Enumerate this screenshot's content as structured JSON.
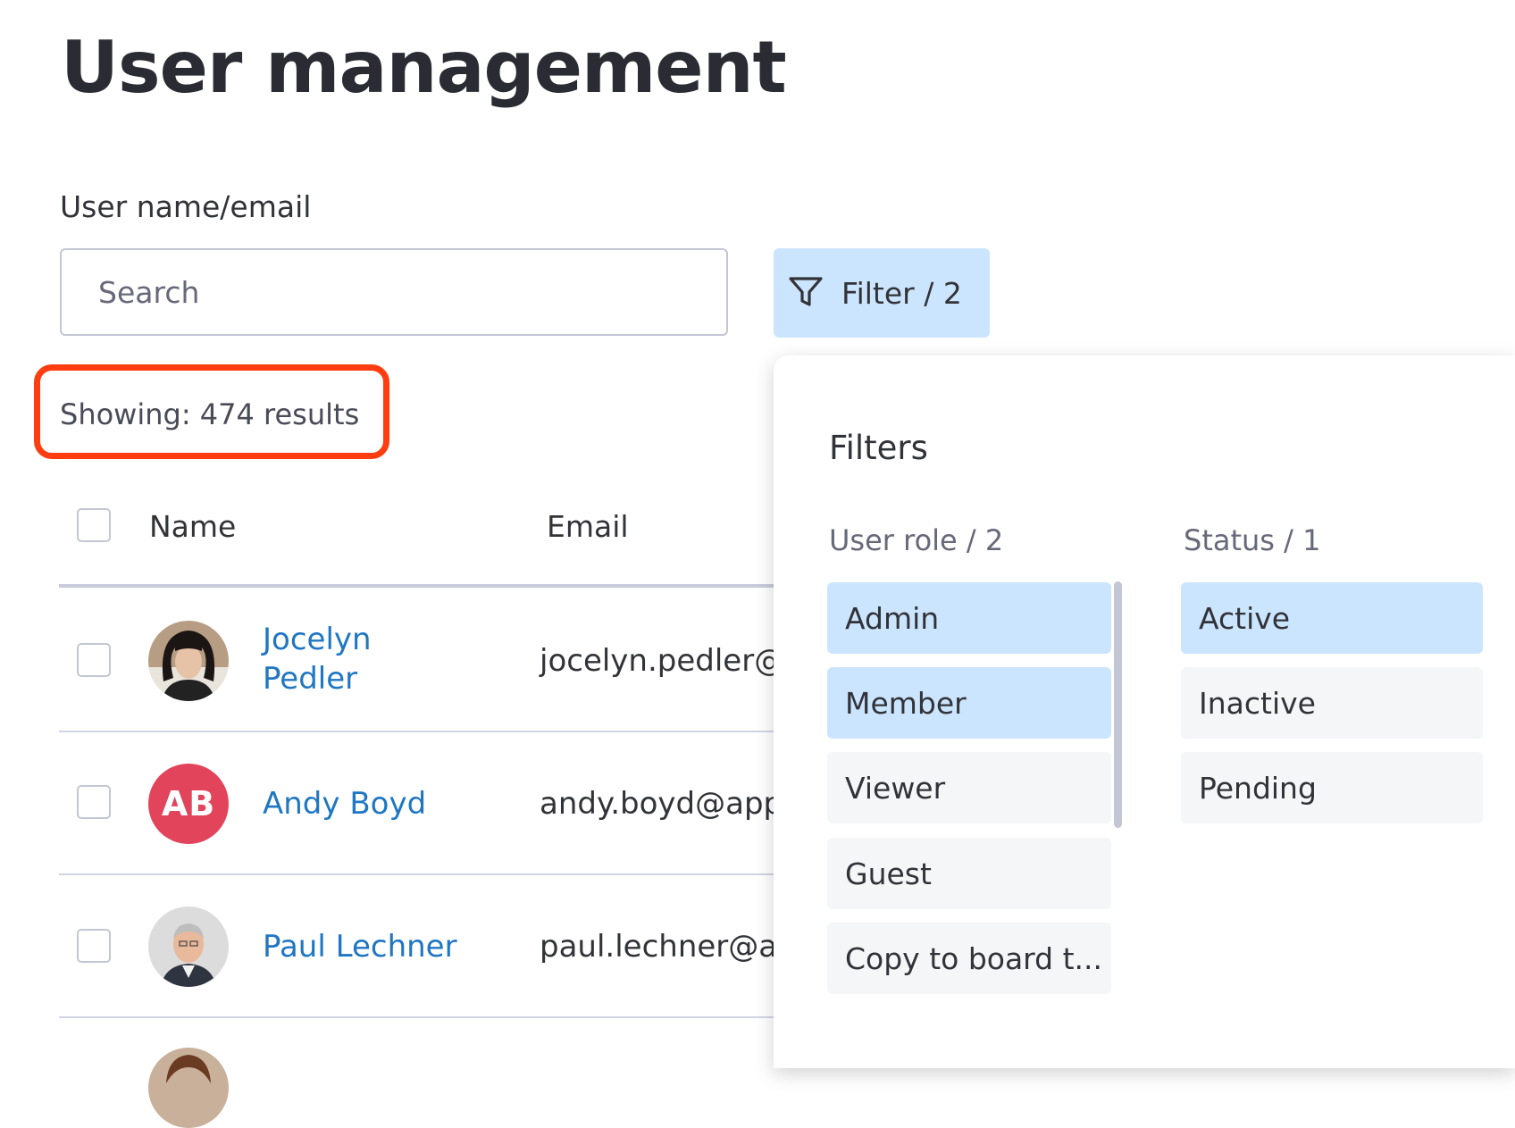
{
  "page": {
    "title": "User management"
  },
  "search": {
    "label": "User name/email",
    "placeholder": "Search",
    "value": ""
  },
  "filter_button": {
    "label": "Filter / 2",
    "icon": "funnel-icon"
  },
  "results": {
    "text": "Showing: 474 results",
    "highlight_color": "#ff3d10"
  },
  "table": {
    "columns": [
      "Name",
      "Email"
    ],
    "rows": [
      {
        "name_line1": "Jocelyn",
        "name_line2": "Pedler",
        "email": "jocelyn.pedler@a",
        "avatar": "photo"
      },
      {
        "name": "Andy Boyd",
        "email": "andy.boyd@appf",
        "avatar_initials": "AB",
        "avatar_color": "#e2445c"
      },
      {
        "name": "Paul Lechner",
        "email": "paul.lechner@ap",
        "avatar": "photo"
      }
    ]
  },
  "filters_panel": {
    "title": "Filters",
    "user_role": {
      "heading": "User role / 2",
      "options": [
        {
          "label": "Admin",
          "selected": true
        },
        {
          "label": "Member",
          "selected": true
        },
        {
          "label": "Viewer",
          "selected": false
        },
        {
          "label": "Guest",
          "selected": false
        },
        {
          "label": "Copy to board t...",
          "selected": false
        }
      ]
    },
    "status": {
      "heading": "Status / 1",
      "options": [
        {
          "label": "Active",
          "selected": true
        },
        {
          "label": "Inactive",
          "selected": false
        },
        {
          "label": "Pending",
          "selected": false
        }
      ]
    }
  },
  "colors": {
    "link": "#1f76c2",
    "selected_bg": "#cce5ff",
    "unselected_bg": "#f5f6f8"
  }
}
